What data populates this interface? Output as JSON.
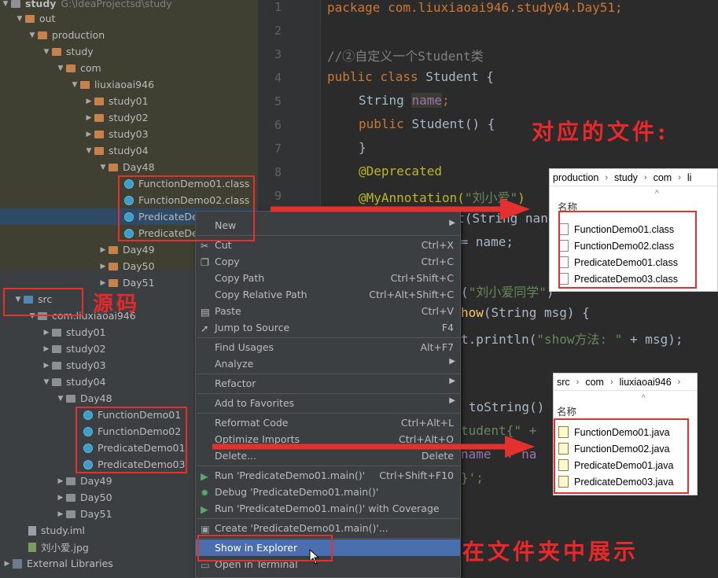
{
  "project_tree": {
    "top_partial": {
      "label": "study",
      "path": "G:\\IdeaProjectsd\\study"
    },
    "items": [
      {
        "label": "out",
        "icon": "folder-icon"
      },
      {
        "label": "production",
        "icon": "folder-icon"
      },
      {
        "label": "study",
        "icon": "folder-icon"
      },
      {
        "label": "com",
        "icon": "folder-icon"
      },
      {
        "label": "liuxiaoai946",
        "icon": "folder-icon"
      },
      {
        "label": "study01",
        "icon": "folder-icon"
      },
      {
        "label": "study02",
        "icon": "folder-icon"
      },
      {
        "label": "study03",
        "icon": "folder-icon"
      },
      {
        "label": "study04",
        "icon": "folder-icon"
      },
      {
        "label": "Day48",
        "icon": "folder-icon"
      },
      {
        "label": "FunctionDemo01.class",
        "icon": "class-file-icon"
      },
      {
        "label": "FunctionDemo02.class",
        "icon": "class-file-icon"
      },
      {
        "label": "PredicateDe",
        "icon": "class-file-icon"
      },
      {
        "label": "PredicateDe",
        "icon": "class-file-icon"
      },
      {
        "label": "Day49",
        "icon": "folder-icon"
      },
      {
        "label": "Day50",
        "icon": "folder-icon"
      },
      {
        "label": "Day51",
        "icon": "folder-icon"
      },
      {
        "label": "src",
        "icon": "source-folder-icon"
      },
      {
        "label": "com.liuxiaoai946",
        "icon": "package-icon"
      },
      {
        "label": "study01",
        "icon": "package-icon"
      },
      {
        "label": "study02",
        "icon": "package-icon"
      },
      {
        "label": "study03",
        "icon": "package-icon"
      },
      {
        "label": "study04",
        "icon": "package-icon"
      },
      {
        "label": "Day48",
        "icon": "package-icon"
      },
      {
        "label": "FunctionDemo01",
        "icon": "class-icon"
      },
      {
        "label": "FunctionDemo02",
        "icon": "class-icon"
      },
      {
        "label": "PredicateDemo01",
        "icon": "class-icon"
      },
      {
        "label": "PredicateDemo03",
        "icon": "class-icon"
      },
      {
        "label": "Day49",
        "icon": "package-icon"
      },
      {
        "label": "Day50",
        "icon": "package-icon"
      },
      {
        "label": "Day51",
        "icon": "package-icon"
      },
      {
        "label": "study.iml",
        "icon": "file-icon"
      },
      {
        "label": "刘小爱.jpg",
        "icon": "image-file-icon"
      },
      {
        "label": "External Libraries",
        "icon": "library-icon"
      }
    ]
  },
  "editor": {
    "line_numbers": [
      "1",
      "2",
      "3",
      "4",
      "5",
      "6",
      "7",
      "8",
      "9"
    ],
    "lines": {
      "l1": "package com.liuxiaoai946.study04.Day51;",
      "l3": "//②自定义一个Student类",
      "l4a": "public class ",
      "l4b": "Student {",
      "l5a": "String ",
      "l5b": "name",
      "l5c": ";",
      "l6a": "public ",
      "l6b": "Student() {",
      "l7": "}",
      "l8": "@Deprecated",
      "l9a": "@MyAnnotation(",
      "l9b": "\"刘小爱\"",
      "l9c": ")",
      "l10": "public Student(String nan",
      "l11": " = name;",
      "l13a": "(",
      "l13b": "\"刘小爱同学\"",
      "l13c": ")",
      "l14a": "how",
      "l14b": "(String msg) {",
      "l15a": "t.println(",
      "l15b": "\"show方法: \"",
      "l15c": " + msg);",
      "l17": "toString()",
      "l18": "tudent{\" +",
      "l19": "name  + na",
      "l20": "}';"
    }
  },
  "context_menu": {
    "items": [
      {
        "label": "New",
        "submenu": true
      },
      {
        "label": "Cut",
        "shortcut": "Ctrl+X",
        "icon": "scissors-icon"
      },
      {
        "label": "Copy",
        "shortcut": "Ctrl+C",
        "icon": "copy-icon"
      },
      {
        "label": "Copy Path",
        "shortcut": "Ctrl+Shift+C"
      },
      {
        "label": "Copy Relative Path",
        "shortcut": "Ctrl+Alt+Shift+C"
      },
      {
        "label": "Paste",
        "shortcut": "Ctrl+V",
        "icon": "paste-icon"
      },
      {
        "label": "Jump to Source",
        "shortcut": "F4",
        "icon": "jump-icon"
      },
      {
        "label": "Find Usages",
        "shortcut": "Alt+F7"
      },
      {
        "label": "Analyze",
        "submenu": true
      },
      {
        "label": "Refactor",
        "submenu": true
      },
      {
        "label": "Add to Favorites",
        "submenu": true
      },
      {
        "label": "Reformat Code",
        "shortcut": "Ctrl+Alt+L"
      },
      {
        "label": "Optimize Imports",
        "shortcut": "Ctrl+Alt+O"
      },
      {
        "label": "Delete...",
        "shortcut": "Delete"
      },
      {
        "label": "Run 'PredicateDemo01.main()'",
        "shortcut": "Ctrl+Shift+F10",
        "icon": "run-icon"
      },
      {
        "label": "Debug 'PredicateDemo01.main()'",
        "icon": "debug-icon"
      },
      {
        "label": "Run 'PredicateDemo01.main()' with Coverage",
        "icon": "coverage-icon"
      },
      {
        "label": "Create 'PredicateDemo01.main()'...",
        "icon": "create-config-icon"
      },
      {
        "label": "Show in Explorer",
        "highlighted": true
      },
      {
        "label": "Open in Terminal",
        "icon": "terminal-icon"
      }
    ]
  },
  "annotations": {
    "corresponding_files": "对应的文件:",
    "source_code": "源码",
    "show_in_folder": "在文件夹中展示"
  },
  "explorer_class": {
    "breadcrumb": [
      "production",
      "study",
      "com",
      "li"
    ],
    "header": "名称",
    "files": [
      "FunctionDemo01.class",
      "FunctionDemo02.class",
      "PredicateDemo01.class",
      "PredicateDemo03.class"
    ]
  },
  "explorer_java": {
    "breadcrumb": [
      "src",
      "com",
      "liuxiaoai946"
    ],
    "header": "名称",
    "files": [
      "FunctionDemo01.java",
      "FunctionDemo02.java",
      "PredicateDemo01.java",
      "PredicateDemo03.java"
    ]
  },
  "colors": {
    "annotation_red": "#e53030",
    "menu_highlight": "#4b6eaf",
    "keyword": "#cc7832",
    "annotation": "#bbb529",
    "string": "#6a8759"
  }
}
